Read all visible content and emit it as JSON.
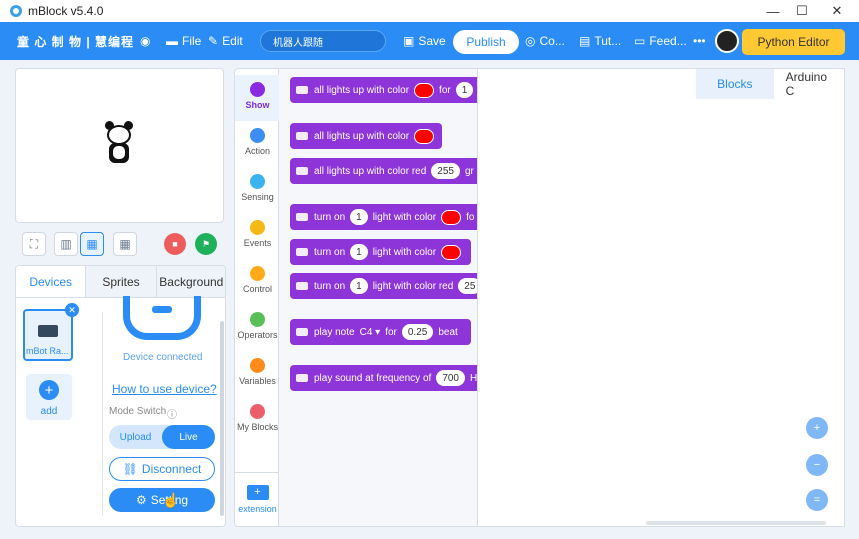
{
  "window": {
    "title": "mBlock v5.4.0"
  },
  "menu": {
    "brand": "童 心 制 物 | 慧编程",
    "file": "File",
    "edit": "Edit",
    "project_name": "机器人跟随",
    "save": "Save",
    "publish": "Publish",
    "courses": "Co...",
    "tutorials": "Tut...",
    "feedback": "Feed...",
    "more": "•••",
    "python_editor": "Python Editor"
  },
  "stage_controls": {
    "icons": [
      "fullscreen-icon",
      "small-stage-icon",
      "large-stage-icon",
      "grid-icon",
      "stop-icon",
      "green-flag-icon"
    ]
  },
  "device_panel": {
    "tabs": [
      "Devices",
      "Sprites",
      "Background"
    ],
    "active_tab": "Devices",
    "device_label": "mBot Ra...",
    "add_label": "add",
    "status": "Device connected",
    "how_to": "How to use device?",
    "mode_switch": "Mode Switch",
    "upload": "Upload",
    "live": "Live",
    "disconnect": "Disconnect",
    "setting": "Setting"
  },
  "categories": [
    {
      "label": "Show",
      "color": "#8a2be2",
      "active": true
    },
    {
      "label": "Action",
      "color": "#3d8df5"
    },
    {
      "label": "Sensing",
      "color": "#3ab3ef"
    },
    {
      "label": "Events",
      "color": "#f5b914"
    },
    {
      "label": "Control",
      "color": "#ffab19"
    },
    {
      "label": "Operators",
      "color": "#59c059"
    },
    {
      "label": "Variables",
      "color": "#ff8c1a"
    },
    {
      "label": "My Blocks",
      "color": "#ec5f6a"
    }
  ],
  "extension_label": "extension",
  "blocks": [
    {
      "t1": "all lights up with color",
      "t2": "for",
      "n1": "1"
    },
    {
      "t1": "all lights up with color"
    },
    {
      "t1": "all lights up with color red",
      "n1": "255",
      "t2": "gr"
    },
    {
      "t1": "turn on",
      "n1": "1",
      "t2": "light with color",
      "t3": "fo"
    },
    {
      "t1": "turn on",
      "n1": "1",
      "t2": "light with color"
    },
    {
      "t1": "turn on",
      "n1": "1",
      "t2": "light with color red",
      "n2": "25"
    },
    {
      "t1": "play note",
      "note": "C4 ▾",
      "t2": "for",
      "n1": "0.25",
      "t3": "beat"
    },
    {
      "t1": "play sound at frequency of",
      "n1": "700",
      "t2": "H"
    }
  ],
  "code_tabs": {
    "blocks": "Blocks",
    "arduino": "Arduino C"
  },
  "colors": {
    "accent": "#2a8cf4",
    "show_block": "#8d35d9",
    "python_button": "#ffc933",
    "led": "#ff0000",
    "stop": "#ee5d5d",
    "go": "#1fb05c"
  }
}
